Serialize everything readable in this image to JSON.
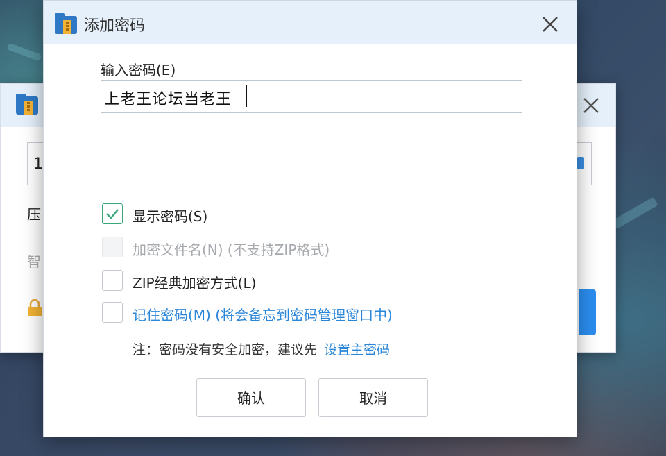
{
  "background_window": {
    "input_value": "1",
    "label1": "压",
    "label2": "智",
    "icons": [
      "archive-app-icon",
      "close-icon",
      "lock-icon"
    ]
  },
  "dialog": {
    "title": "添加密码",
    "app_icon": "archive-app-icon",
    "close_icon": "close-icon",
    "password_label": "输入密码(E)",
    "password_value": "上老王论坛当老王",
    "options": [
      {
        "label": "显示密码(S)",
        "checked": true,
        "disabled": false,
        "style": "normal"
      },
      {
        "label": "加密文件名(N) (不支持ZIP格式)",
        "checked": false,
        "disabled": true,
        "style": "disabled"
      },
      {
        "label": "ZIP经典加密方式(L)",
        "checked": false,
        "disabled": false,
        "style": "normal"
      },
      {
        "label": "记住密码(M) (将会备忘到密码管理窗口中)",
        "checked": false,
        "disabled": false,
        "style": "link"
      }
    ],
    "note_text": "注：密码没有安全加密，建议先",
    "note_link": "设置主密码",
    "confirm_label": "确认",
    "cancel_label": "取消"
  },
  "colors": {
    "titlebar_bg": "#e6f0fb",
    "accent_link": "#2a86d8",
    "check_green": "#3aa77a",
    "primary_blue": "#2b8ef0"
  }
}
